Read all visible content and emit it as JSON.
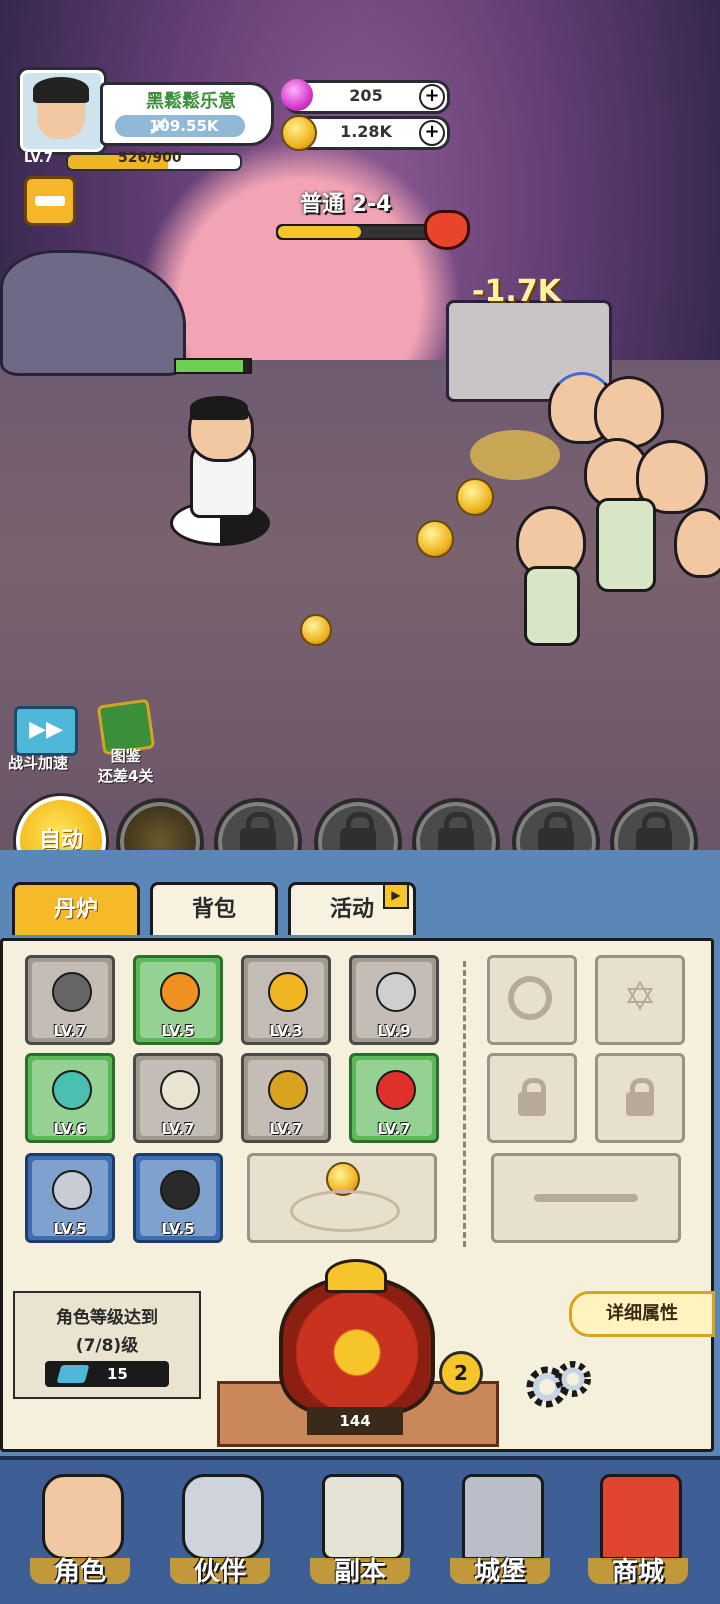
{
  "player": {
    "name": "黑鬆鬆乐意",
    "power": "109.55K",
    "level": "LV.7",
    "exp": "526/900",
    "exp_fraction": 0.584
  },
  "currency": {
    "gems": "205",
    "coins": "1.28K"
  },
  "stage": {
    "label": "普通 2-4",
    "progress_fraction": 0.52
  },
  "battle": {
    "damage_text": "-1.7K",
    "player_hp_fraction": 0.9
  },
  "side_buttons": {
    "speed_label": "战斗加速",
    "codex_line1": "图鉴",
    "codex_line2": "还差4关"
  },
  "skills": {
    "auto_label": "自动"
  },
  "tabs": [
    {
      "label": "丹炉"
    },
    {
      "label": "背包"
    },
    {
      "label": "活动"
    }
  ],
  "equipment": [
    {
      "level": "LV.7",
      "rarity": "gray",
      "icon": "cleaver-icon"
    },
    {
      "level": "LV.5",
      "rarity": "green",
      "icon": "helmet-icon"
    },
    {
      "level": "LV.3",
      "rarity": "gray",
      "icon": "gong-icon"
    },
    {
      "level": "LV.9",
      "rarity": "gray",
      "icon": "dog-medal-icon"
    },
    {
      "level": "LV.6",
      "rarity": "green",
      "icon": "armor-icon"
    },
    {
      "level": "LV.7",
      "rarity": "gray",
      "icon": "plate-icon"
    },
    {
      "level": "LV.7",
      "rarity": "gray",
      "icon": "necklace-icon"
    },
    {
      "level": "LV.7",
      "rarity": "green",
      "icon": "red-orb-icon"
    },
    {
      "level": "LV.5",
      "rarity": "blue",
      "icon": "bracer-icon"
    },
    {
      "level": "LV.5",
      "rarity": "blue",
      "icon": "boots-icon"
    }
  ],
  "requirement": {
    "line1": "角色等级达到",
    "line2": "(7/8)级",
    "cost": "15"
  },
  "detail_label": "详细属性",
  "furnace": {
    "cost": "144",
    "badge": "2"
  },
  "nav": [
    {
      "label": "角色"
    },
    {
      "label": "伙伴"
    },
    {
      "label": "副本"
    },
    {
      "label": "城堡"
    },
    {
      "label": "商城"
    }
  ]
}
